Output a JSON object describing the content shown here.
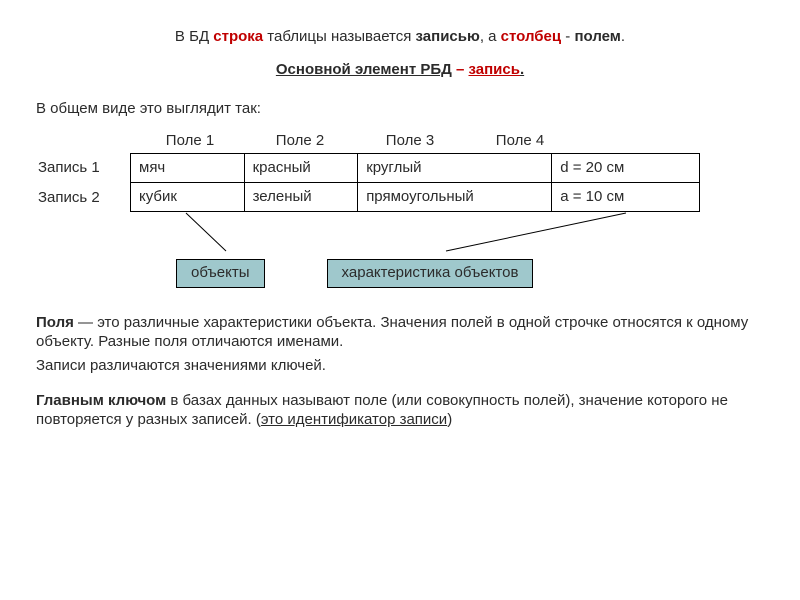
{
  "title1": {
    "pre": "В БД ",
    "word1": "строка",
    "mid1": " таблицы называется ",
    "word2": "записью",
    "mid2": ", а ",
    "word3": "столбец",
    "mid3": " - ",
    "word4": "полем",
    "end": "."
  },
  "title2": {
    "text1": "Основной элемент РБД",
    "dash": " – ",
    "text2": "запись",
    "end": "."
  },
  "intro": "В общем виде это выглядит так:",
  "cols": {
    "c1": "Поле 1",
    "c2": "Поле 2",
    "c3": "Поле 3",
    "c4": "Поле 4"
  },
  "rows": {
    "r1": "Запись 1",
    "r2": "Запись 2"
  },
  "cells": {
    "r1c1": "мяч",
    "r1c2": "красный",
    "r1c3": "круглый",
    "r1c4": "d = 20 см",
    "r2c1": "кубик",
    "r2c2": "зеленый",
    "r2c3": "прямоугольный",
    "r2c4": "a = 10 см"
  },
  "box1": "объекты",
  "box2": "характеристика объектов",
  "para1": {
    "lead": "Поля",
    "rest": " — это различные характеристики объекта. Значения полей в одной строчке относятся к одному объекту. Разные поля отличаются именами."
  },
  "para2": "Записи различаются значениями ключей.",
  "para3": {
    "lead": "Главным ключом",
    "rest": " в базах данных называют поле (или совокупность полей), значение которого не повторяется у разных записей. (",
    "ul": "это идентификатор записи",
    "end": ")"
  }
}
